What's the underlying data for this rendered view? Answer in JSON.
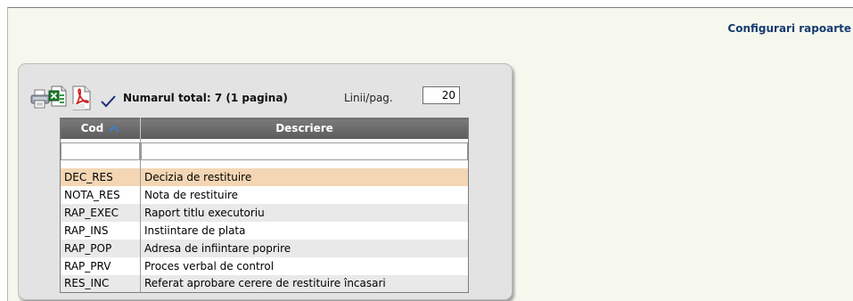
{
  "header": {
    "title": "Configurari rapoarte"
  },
  "toolbar": {
    "total_text": "Numarul total: 7 (1 pagina)",
    "lines_label": "Linii/pag.",
    "lines_value": "20"
  },
  "table": {
    "columns": {
      "code": "Cod",
      "description": "Descriere"
    },
    "rows": [
      {
        "code": "DEC_RES",
        "description": "Decizia de restituire"
      },
      {
        "code": "NOTA_RES",
        "description": "Nota de restituire"
      },
      {
        "code": "RAP_EXEC",
        "description": "Raport titlu executoriu"
      },
      {
        "code": "RAP_INS",
        "description": "Instiintare de plata"
      },
      {
        "code": "RAP_POP",
        "description": "Adresa de infiintare poprire"
      },
      {
        "code": "RAP_PRV",
        "description": "Proces verbal de control"
      },
      {
        "code": "RES_INC",
        "description": "Referat aprobare cerere de restituire încasari"
      }
    ]
  }
}
